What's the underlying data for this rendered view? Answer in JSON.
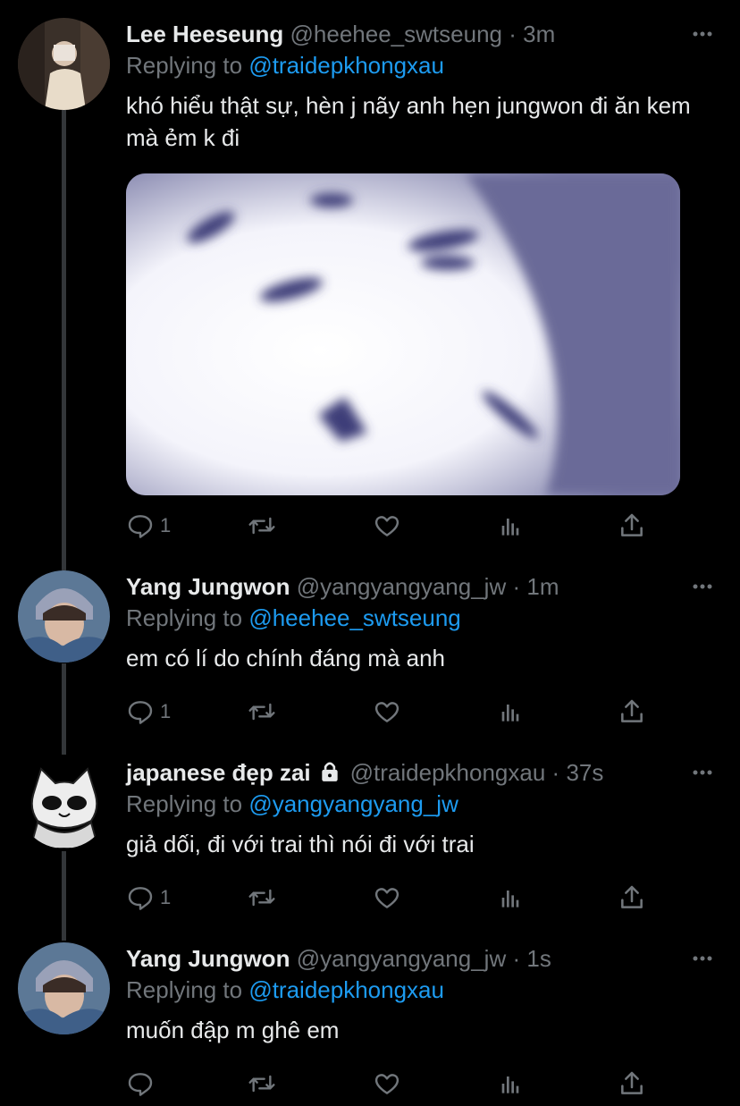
{
  "tweets": [
    {
      "name": "Lee Heeseung",
      "handle": "@heehee_swtseung",
      "time": "3m",
      "replying_prefix": "Replying to",
      "replying_to": "@traidepkhongxau",
      "text": "khó hiểu thật sự, hèn j nãy anh hẹn jungwon đi ăn kem mà ẻm k đi",
      "reply_count": "1",
      "has_media": true
    },
    {
      "name": "Yang Jungwon",
      "handle": "@yangyangyang_jw",
      "time": "1m",
      "replying_prefix": "Replying to",
      "replying_to": "@heehee_swtseung",
      "text": "em có lí do chính đáng mà anh",
      "reply_count": "1"
    },
    {
      "name": "japanese đẹp zai",
      "handle": "@traidepkhongxau",
      "time": "37s",
      "replying_prefix": "Replying to",
      "replying_to": "@yangyangyang_jw",
      "text": "giả dối, đi với trai thì nói đi với trai",
      "reply_count": "1",
      "protected": true
    },
    {
      "name": "Yang Jungwon",
      "handle": "@yangyangyang_jw",
      "time": "1s",
      "replying_prefix": "Replying to",
      "replying_to": "@traidepkhongxau",
      "text": "muốn đập m ghê em",
      "reply_count": ""
    }
  ],
  "separator": "·",
  "icons": [
    "reply-icon",
    "retweet-icon",
    "like-icon",
    "analytics-icon",
    "share-icon",
    "more-icon",
    "lock-icon"
  ],
  "colors": {
    "background": "#000000",
    "link": "#1d9bf0",
    "muted": "#71767b",
    "text": "#e7e9ea"
  }
}
